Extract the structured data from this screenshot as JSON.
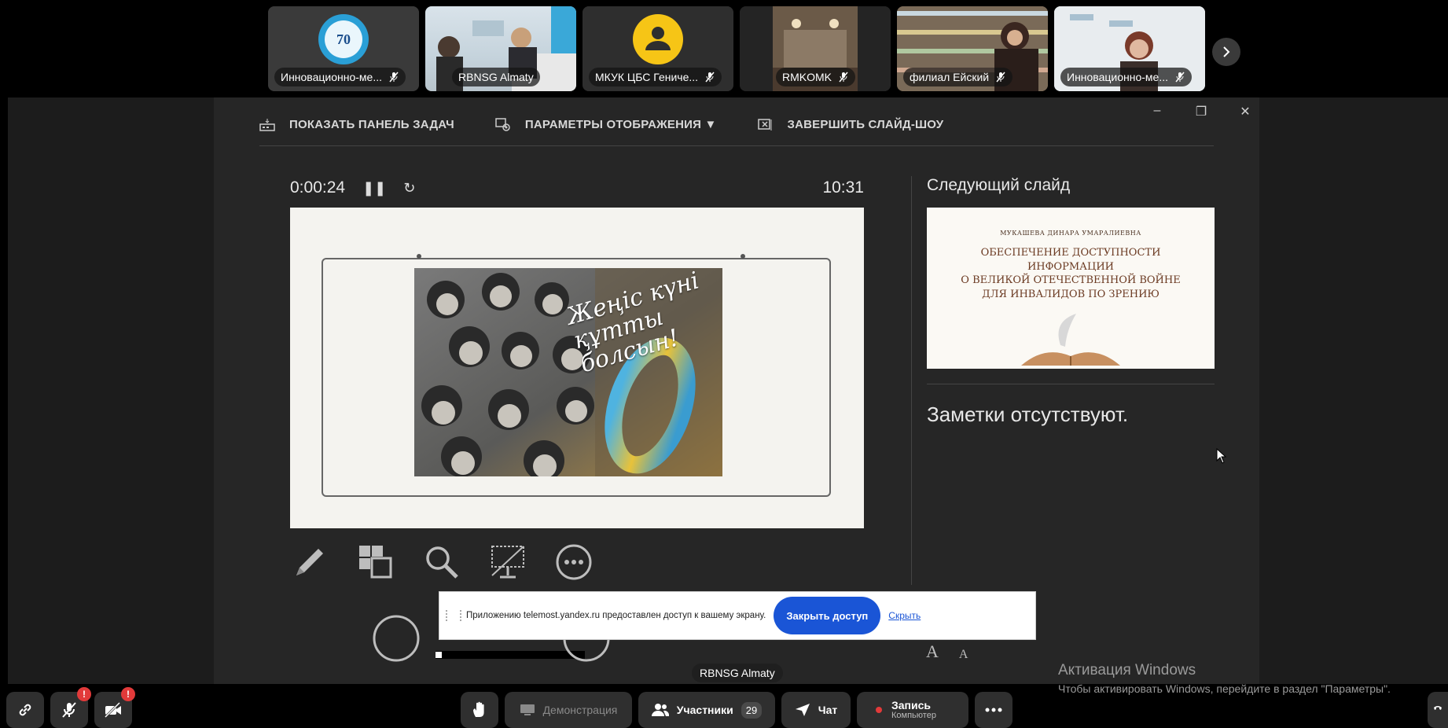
{
  "participants": [
    {
      "name": "Инновационно-ме...",
      "kind": "logo",
      "logo_text": "70"
    },
    {
      "name": "RBNSG Almaty",
      "kind": "video"
    },
    {
      "name": "МКУК ЦБС Гениче...",
      "kind": "avatar"
    },
    {
      "name": "RMKOMK",
      "kind": "video"
    },
    {
      "name": "филиал Ейский",
      "kind": "video"
    },
    {
      "name": "Инновационно-ме...",
      "kind": "video"
    }
  ],
  "ppt": {
    "toolbar": {
      "show_taskbar": "ПОКАЗАТЬ ПАНЕЛЬ ЗАДАЧ",
      "display_settings": "ПАРАМЕТРЫ ОТОБРАЖЕНИЯ ▼",
      "end_slideshow": "ЗАВЕРШИТЬ СЛАЙД-ШОУ"
    },
    "window_controls": {
      "minimize": "–",
      "restore": "❐",
      "close": "✕"
    },
    "elapsed": "0:00:24",
    "clock": "10:31",
    "current_slide_caption": "Жеңіс күні құтты болсын!",
    "next_slide_label": "Следующий слайд",
    "next_slide": {
      "author": "МУКАШЕВА ДИНАРА УМАРАЛИЕВНА",
      "title_lines": [
        "ОБЕСПЕЧЕНИЕ ДОСТУПНОСТИ",
        "ИНФОРМАЦИИ",
        "О ВЕЛИКОЙ ОТЕЧЕСТВЕННОЙ ВОЙНЕ",
        "ДЛЯ ИНВАЛИДОВ ПО ЗРЕНИЮ"
      ]
    },
    "notes": "Заметки отсутствуют.",
    "font_controls": {
      "increase": "A",
      "decrease": "A"
    }
  },
  "share_banner": {
    "message": "Приложению telemost.yandex.ru предоставлен доступ к вашему экрану.",
    "close_access": "Закрыть доступ",
    "hide": "Скрыть"
  },
  "sharer_label": "RBNSG Almaty",
  "activation": {
    "line1": "Активация Windows",
    "line2": "Чтобы активировать Windows, перейдите в раздел \"Параметры\"."
  },
  "controls": {
    "mic_badge": "!",
    "cam_badge": "!",
    "demonstration": "Демонстрация",
    "participants": "Участники",
    "participants_count": "29",
    "chat": "Чат",
    "record": "Запись",
    "record_sub": "Компьютер"
  },
  "colors": {
    "accent_blue": "#1a55d6",
    "badge_red": "#e23a3a",
    "panel": "#262626"
  }
}
